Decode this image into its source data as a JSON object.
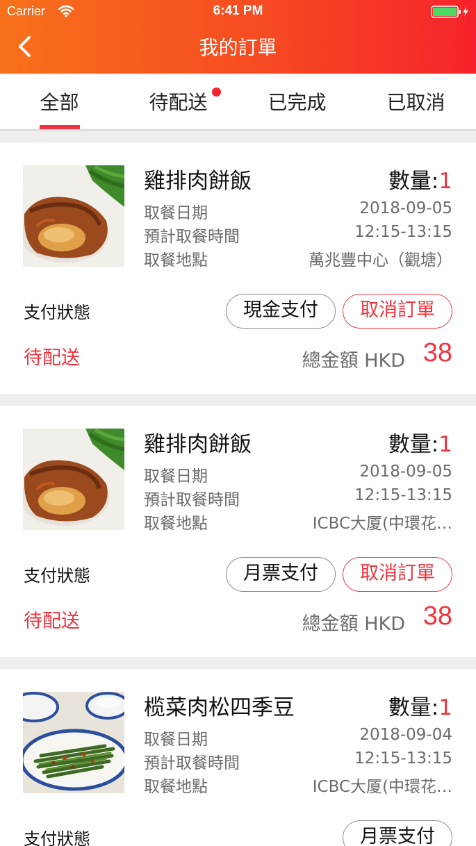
{
  "status_bar": {
    "carrier": "Carrier",
    "time": "6:41 PM"
  },
  "header": {
    "title": "我的訂單"
  },
  "tabs": [
    {
      "label": "全部",
      "active": true
    },
    {
      "label": "待配送",
      "active": false,
      "has_dot": true
    },
    {
      "label": "已完成",
      "active": false
    },
    {
      "label": "已取消",
      "active": false
    }
  ],
  "labels": {
    "quantity": "數量:",
    "pickup_date": "取餐日期",
    "pickup_time": "預計取餐時間",
    "pickup_location": "取餐地點",
    "payment_status": "支付狀態",
    "total": "總金額 HKD",
    "cancel_order": "取消訂單"
  },
  "orders": [
    {
      "dish": "雞排肉餅飯",
      "quantity": "1",
      "date": "2018-09-05",
      "time": "12:15-13:15",
      "location": "萬兆豐中心（觀塘）",
      "payment_method": "現金支付",
      "status": "待配送",
      "total": "38",
      "image": "chicken-cutlet-rice"
    },
    {
      "dish": "雞排肉餅飯",
      "quantity": "1",
      "date": "2018-09-05",
      "time": "12:15-13:15",
      "location": "ICBC大厦(中環花…",
      "payment_method": "月票支付",
      "status": "待配送",
      "total": "38",
      "image": "chicken-cutlet-rice"
    },
    {
      "dish": "榄菜肉松四季豆",
      "quantity": "1",
      "date": "2018-09-04",
      "time": "12:15-13:15",
      "location": "ICBC大厦(中環花…",
      "payment_method": "月票支付",
      "image": "green-beans-minced-pork"
    }
  ],
  "colors": {
    "accent": "#f0343f",
    "header_start": "#f7711a",
    "header_end": "#f5232b"
  }
}
